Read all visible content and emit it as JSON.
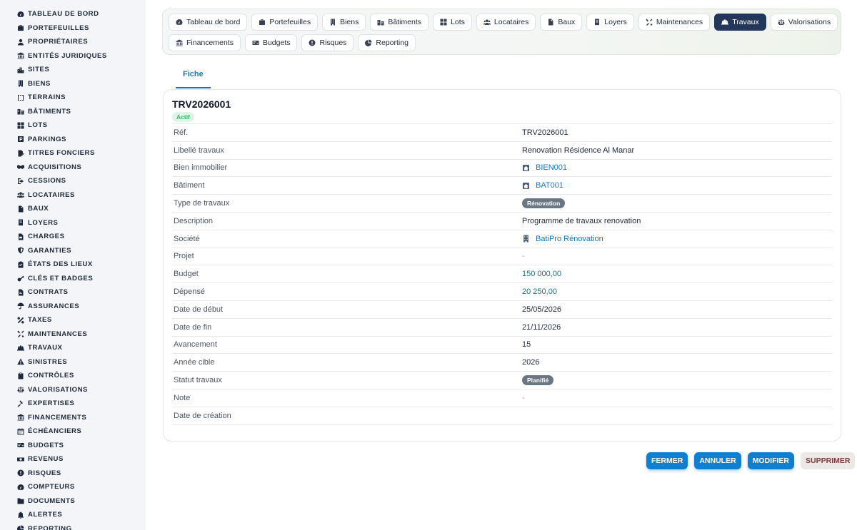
{
  "sidebar": {
    "items": [
      {
        "label": "TABLEAU DE BORD",
        "icon": "gauge-icon"
      },
      {
        "label": "PORTEFEUILLES",
        "icon": "briefcase-icon"
      },
      {
        "label": "PROPRIÉTAIRES",
        "icon": "user-icon"
      },
      {
        "label": "ENTITÉS JURIDIQUES",
        "icon": "landmark-icon"
      },
      {
        "label": "SITES",
        "icon": "city-icon"
      },
      {
        "label": "BIENS",
        "icon": "building-icon"
      },
      {
        "label": "TERRAINS",
        "icon": "square-icon"
      },
      {
        "label": "BÂTIMENTS",
        "icon": "buildings-icon"
      },
      {
        "label": "LOTS",
        "icon": "grid-icon"
      },
      {
        "label": "PARKINGS",
        "icon": "parking-icon"
      },
      {
        "label": "TITRES FONCIERS",
        "icon": "file-signature-icon"
      },
      {
        "label": "ACQUISITIONS",
        "icon": "handshake-icon"
      },
      {
        "label": "CESSIONS",
        "icon": "sign-out-icon"
      },
      {
        "label": "LOCATAIRES",
        "icon": "users-icon"
      },
      {
        "label": "BAUX",
        "icon": "file-icon"
      },
      {
        "label": "LOYERS",
        "icon": "receipt-icon"
      },
      {
        "label": "CHARGES",
        "icon": "file-invoice-icon"
      },
      {
        "label": "GARANTIES",
        "icon": "shield-icon"
      },
      {
        "label": "ÉTATS DES LIEUX",
        "icon": "clipboard-check-icon"
      },
      {
        "label": "CLÉS ET BADGES",
        "icon": "key-icon"
      },
      {
        "label": "CONTRATS",
        "icon": "file-contract-icon"
      },
      {
        "label": "ASSURANCES",
        "icon": "umbrella-icon"
      },
      {
        "label": "TAXES",
        "icon": "percent-icon"
      },
      {
        "label": "MAINTENANCES",
        "icon": "tools-icon"
      },
      {
        "label": "TRAVAUX",
        "icon": "hard-hat-icon"
      },
      {
        "label": "SINISTRES",
        "icon": "warning-icon"
      },
      {
        "label": "CONTRÔLES",
        "icon": "clipboard-icon"
      },
      {
        "label": "VALORISATIONS",
        "icon": "scale-icon"
      },
      {
        "label": "EXPERTISES",
        "icon": "gavel-icon"
      },
      {
        "label": "FINANCEMENTS",
        "icon": "bank-icon"
      },
      {
        "label": "ÉCHÉANCIERS",
        "icon": "calendar-icon"
      },
      {
        "label": "BUDGETS",
        "icon": "money-check-icon"
      },
      {
        "label": "REVENUS",
        "icon": "money-bill-icon"
      },
      {
        "label": "RISQUES",
        "icon": "exclamation-circle-icon"
      },
      {
        "label": "COMPTEURS",
        "icon": "meter-icon"
      },
      {
        "label": "DOCUMENTS",
        "icon": "folder-icon"
      },
      {
        "label": "ALERTES",
        "icon": "bell-icon"
      },
      {
        "label": "REPORTING",
        "icon": "chart-pie-icon"
      }
    ]
  },
  "modules": {
    "row1": [
      {
        "label": "Tableau de bord",
        "icon": "gauge-icon"
      },
      {
        "label": "Portefeuilles",
        "icon": "briefcase-icon"
      },
      {
        "label": "Biens",
        "icon": "building-icon"
      },
      {
        "label": "Bâtiments",
        "icon": "buildings-icon"
      },
      {
        "label": "Lots",
        "icon": "grid-icon"
      },
      {
        "label": "Locataires",
        "icon": "users-icon"
      },
      {
        "label": "Baux",
        "icon": "file-icon"
      },
      {
        "label": "Loyers",
        "icon": "receipt-icon"
      },
      {
        "label": "Maintenances",
        "icon": "tools-icon"
      },
      {
        "label": "Travaux",
        "icon": "hard-hat-icon",
        "active": true
      },
      {
        "label": "Valorisations",
        "icon": "scale-icon"
      }
    ],
    "row2": [
      {
        "label": "Financements",
        "icon": "bank-icon"
      },
      {
        "label": "Budgets",
        "icon": "money-check-icon"
      },
      {
        "label": "Risques",
        "icon": "exclamation-circle-icon"
      },
      {
        "label": "Reporting",
        "icon": "chart-pie-icon"
      }
    ]
  },
  "tabs": [
    {
      "label": "Fiche",
      "active": true
    }
  ],
  "record": {
    "title": "TRV2026001",
    "status_badge": "Actif",
    "fields": [
      {
        "label": "Réf.",
        "value": "TRV2026001",
        "kind": "text"
      },
      {
        "label": "Libellé travaux",
        "value": "Renovation Résidence Al Manar",
        "kind": "text"
      },
      {
        "label": "Bien immobilier",
        "value": "BIEN001",
        "kind": "link",
        "icon": "house-icon"
      },
      {
        "label": "Bâtiment",
        "value": "BAT001",
        "kind": "link",
        "icon": "house-icon"
      },
      {
        "label": "Type de travaux",
        "value": "Rénovation",
        "kind": "pill"
      },
      {
        "label": "Description",
        "value": "Programme de travaux renovation",
        "kind": "text"
      },
      {
        "label": "Société",
        "value": "BatiPro Rénovation",
        "kind": "link",
        "icon": "building-icon"
      },
      {
        "label": "Projet",
        "value": "-",
        "kind": "dash"
      },
      {
        "label": "Budget",
        "value": "150 000,00",
        "kind": "money"
      },
      {
        "label": "Dépensé",
        "value": "20 250,00",
        "kind": "money"
      },
      {
        "label": "Date de début",
        "value": "25/05/2026",
        "kind": "text"
      },
      {
        "label": "Date de fin",
        "value": "21/11/2026",
        "kind": "text"
      },
      {
        "label": "Avancement",
        "value": "15",
        "kind": "text"
      },
      {
        "label": "Année cible",
        "value": "2026",
        "kind": "text"
      },
      {
        "label": "Statut travaux",
        "value": "Planifié",
        "kind": "pill"
      },
      {
        "label": "Note",
        "value": "-",
        "kind": "dash"
      },
      {
        "label": "Date de création",
        "value": "",
        "kind": "text"
      }
    ]
  },
  "actions": {
    "close": "FERMER",
    "cancel": "ANNULER",
    "edit": "MODIFIER",
    "delete": "SUPPRIMER"
  },
  "colors": {
    "accent": "#1478bc",
    "active_module": "#22375a",
    "primary_button": "#0f7fd1",
    "success_badge": "#3bb36c",
    "pill": "#6b7684"
  }
}
